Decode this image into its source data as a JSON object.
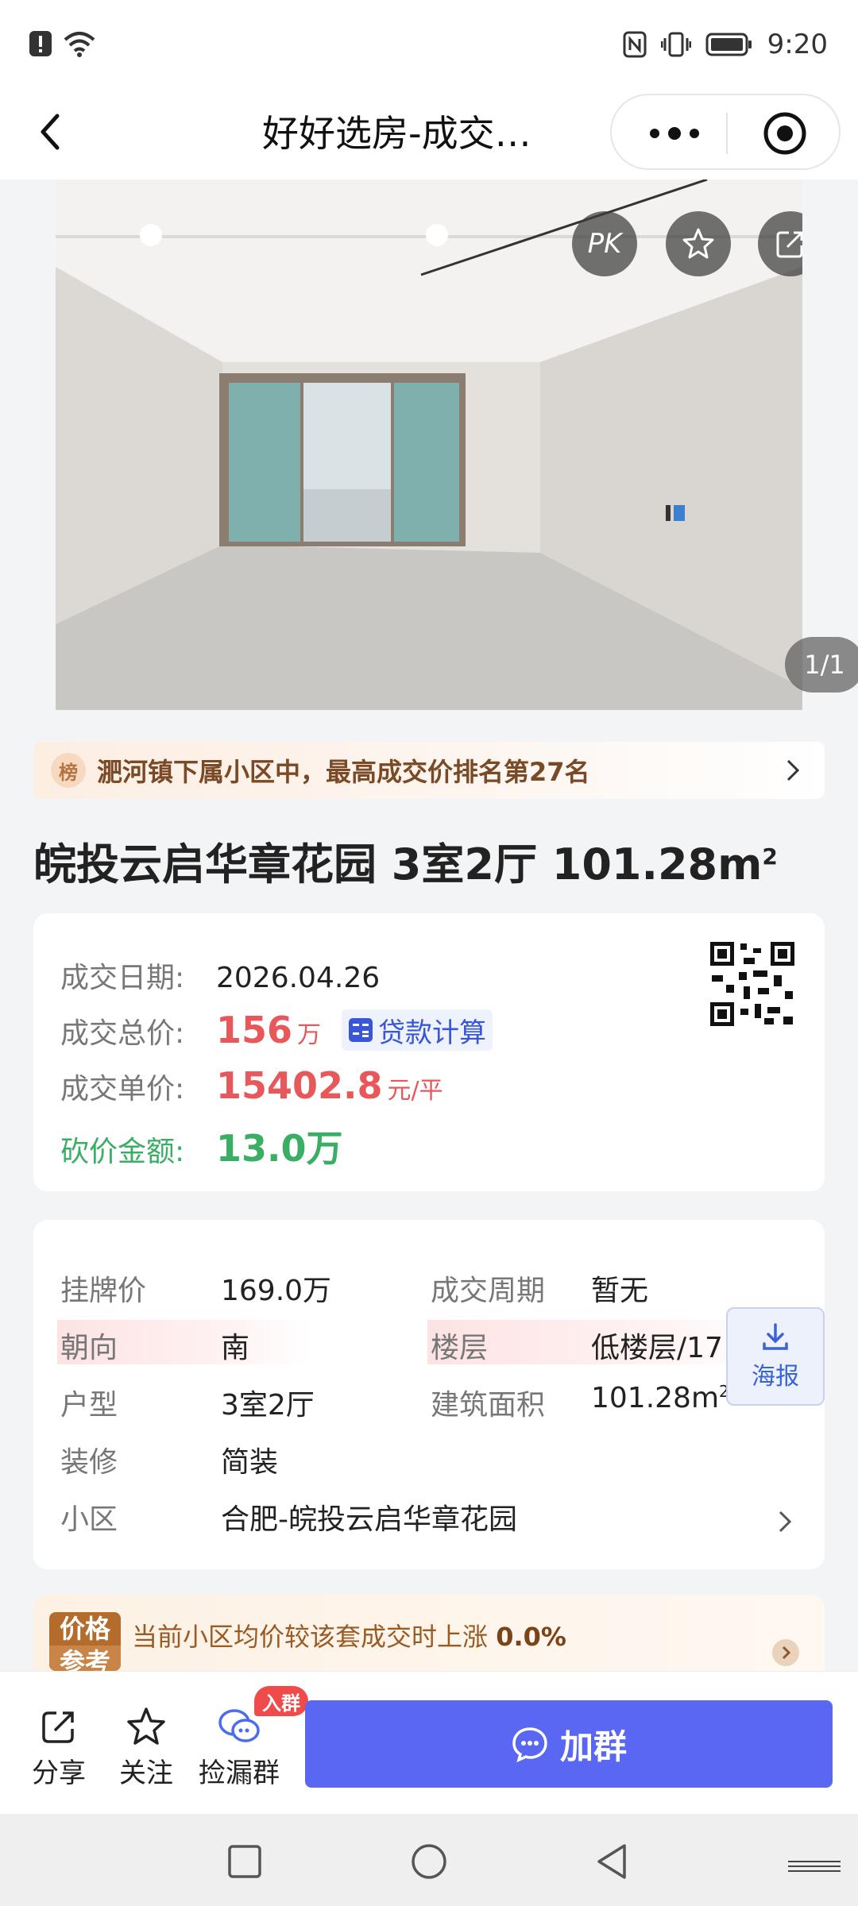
{
  "status_bar": {
    "time": "9:20"
  },
  "nav": {
    "title": "好好选房-成交…"
  },
  "hero": {
    "pk_label": "PK",
    "counter": "1/1"
  },
  "rank_banner": {
    "badge": "榜",
    "text": "淝河镇下属小区中，最高成交价排名第27名"
  },
  "house": {
    "title": "皖投云启华章花园 3室2厅 101.28m",
    "title_sup": "2"
  },
  "deal": {
    "date_label": "成交日期:",
    "date_value": "2026.04.26",
    "total_label": "成交总价:",
    "total_value": "156",
    "total_unit": "万",
    "loan_label": "贷款计算",
    "unit_price_label": "成交单价:",
    "unit_price_value": "15402.8",
    "unit_price_unit": "元/平",
    "cut_label": "砍价金额:",
    "cut_value": "13.0万"
  },
  "info": {
    "list_price_label": "挂牌价",
    "list_price_value": "169.0万",
    "cycle_label": "成交周期",
    "cycle_value": "暂无",
    "orientation_label": "朝向",
    "orientation_value": "南",
    "floor_label": "楼层",
    "floor_value": "低楼层/17",
    "layout_label": "户型",
    "layout_value": "3室2厅",
    "area_label": "建筑面积",
    "area_value": "101.28m",
    "area_sup": "2",
    "decor_label": "装修",
    "decor_value": "简装",
    "community_label": "小区",
    "community_value": "合肥-皖投云启华章花园",
    "poster_label": "海报"
  },
  "reference": {
    "badge_line1": "价格",
    "badge_line2": "参考",
    "text": "当前小区均价较该套成交时上涨",
    "percent": "0.0%"
  },
  "bottom": {
    "share": "分享",
    "follow": "关注",
    "group": "捡漏群",
    "join_badge": "入群",
    "join_button": "加群"
  },
  "colors": {
    "price_red": "#e8575a",
    "cut_green": "#3aae64",
    "join_blue": "#5a67f2"
  }
}
